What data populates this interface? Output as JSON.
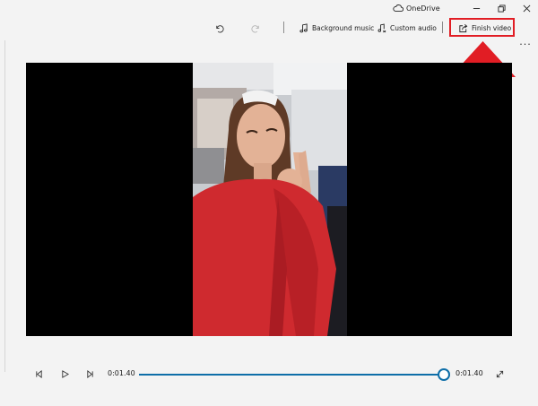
{
  "window": {
    "title": "OneDrive",
    "controls": {
      "minimize": "minimize-icon",
      "restore": "restore-icon",
      "close": "close-icon"
    }
  },
  "toolbar": {
    "undo_icon": "undo-icon",
    "redo_icon": "redo-icon",
    "background_music_label": "Background music",
    "custom_audio_label": "Custom audio",
    "finish_video_label": "Finish video",
    "more_label": "···"
  },
  "annotation": {
    "color": "#e11d24",
    "target": "finish-video-button"
  },
  "playback": {
    "current_time": "0:01.40",
    "total_time": "0:01.40",
    "progress": 1.0,
    "accent_color": "#0e6ea8"
  }
}
